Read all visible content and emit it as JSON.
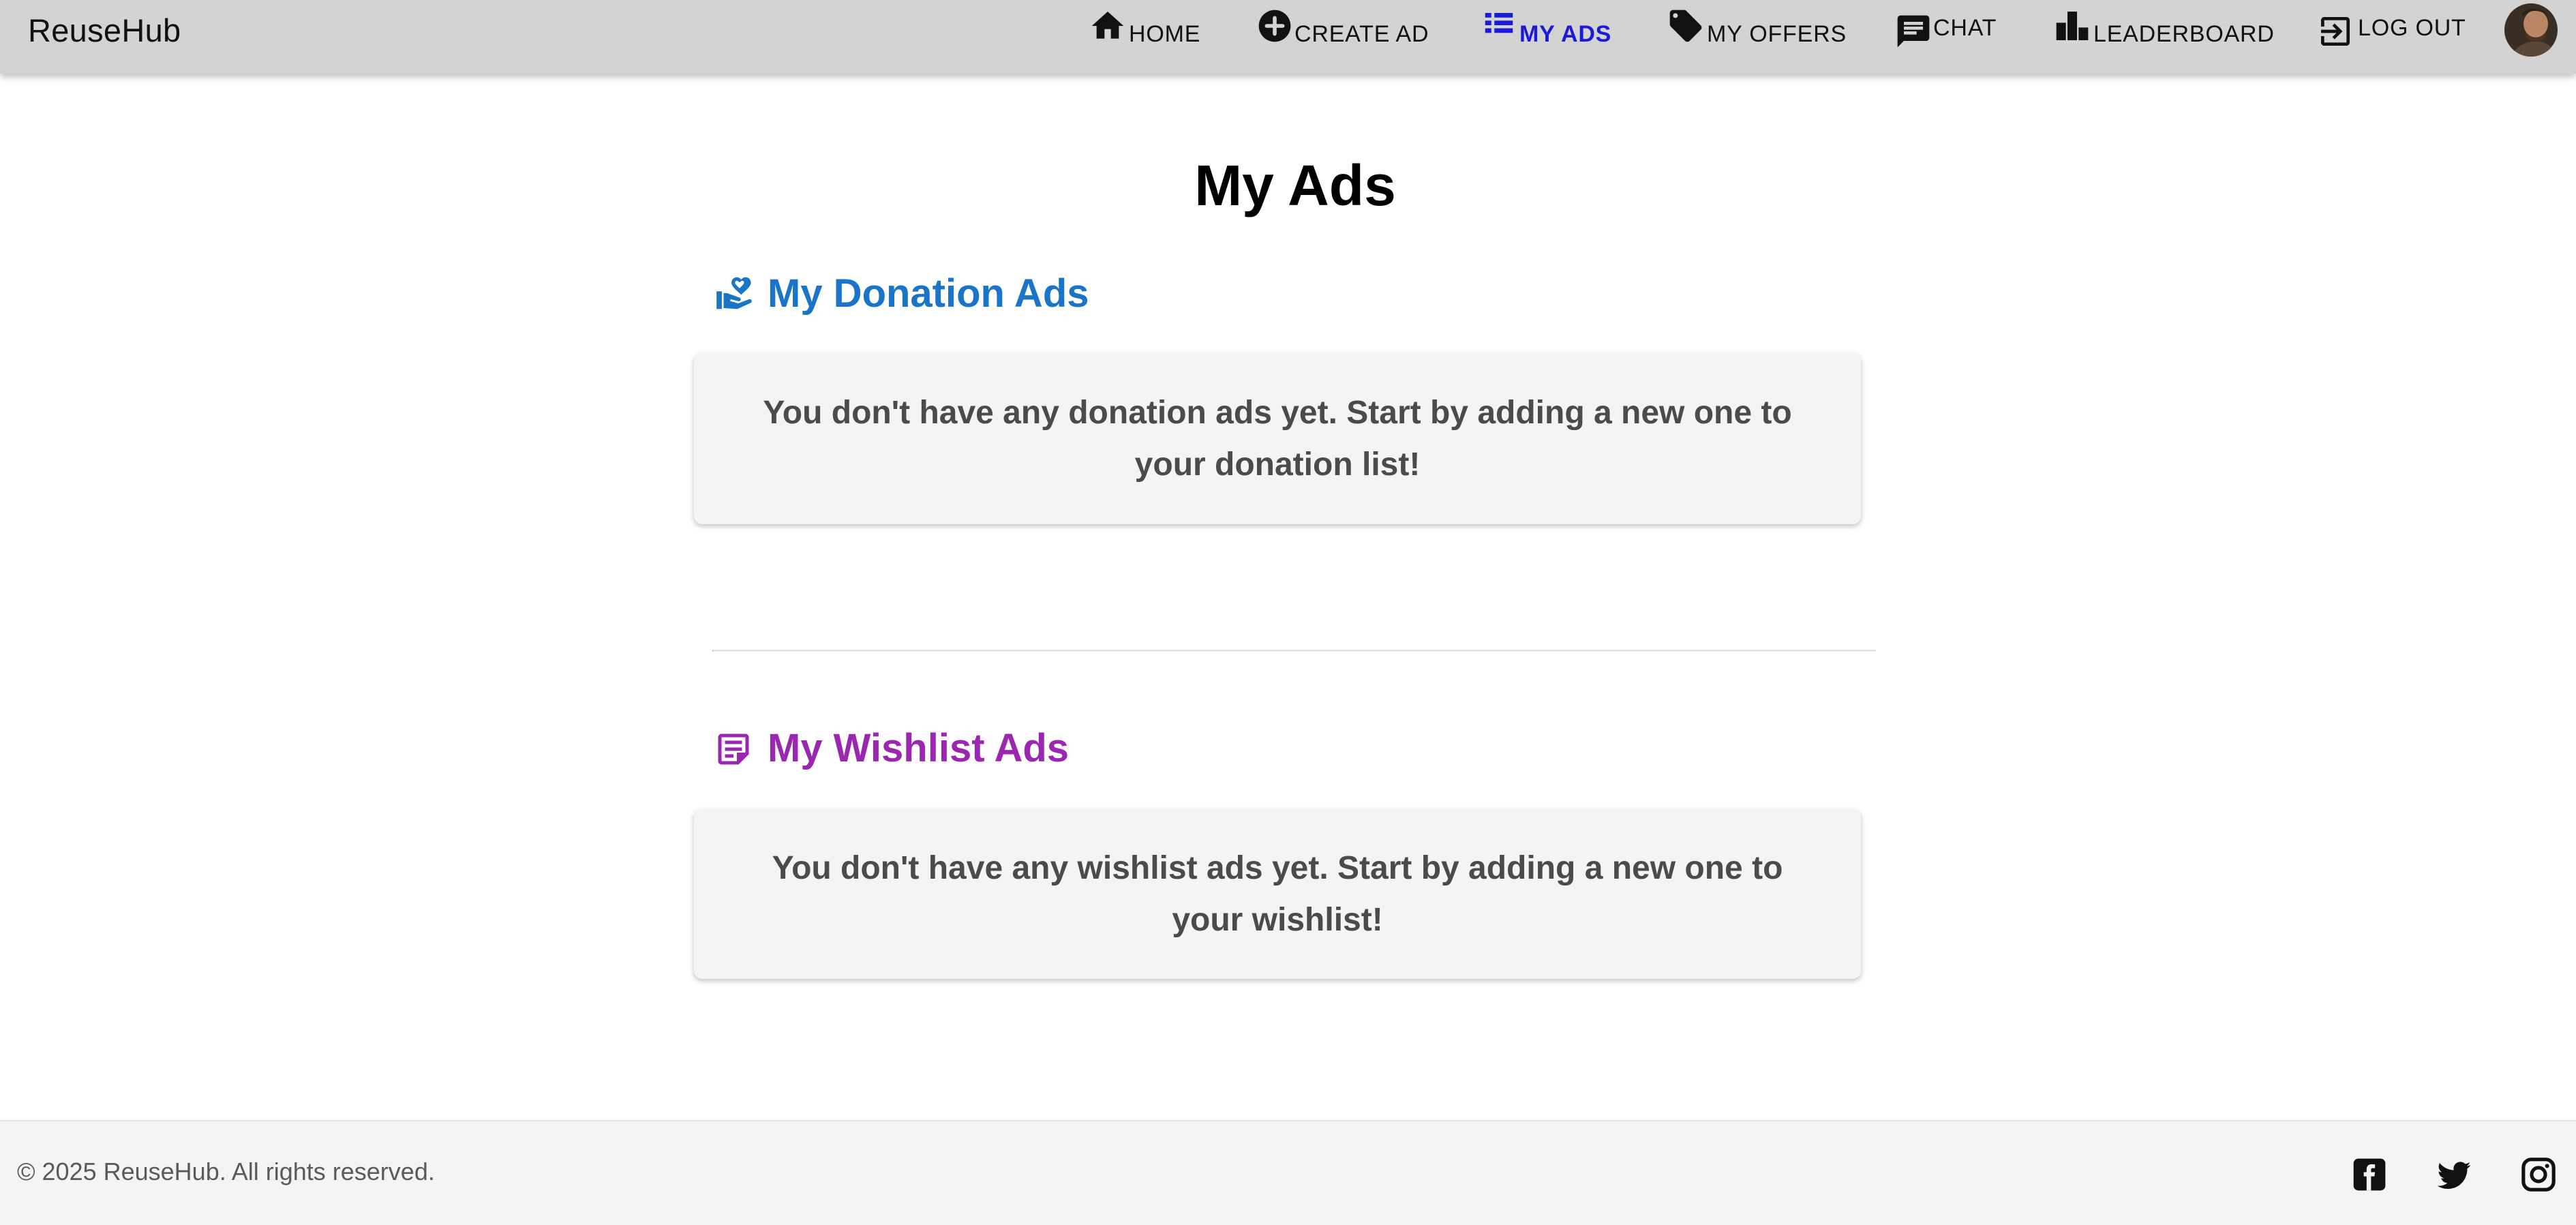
{
  "appbar": {
    "brand": "ReuseHub",
    "nav": {
      "home": {
        "label": "HOME",
        "icon": "home-icon"
      },
      "create_ad": {
        "label": "CREATE AD",
        "icon": "add-circle-icon"
      },
      "my_ads": {
        "label": "MY ADS",
        "icon": "list-icon",
        "active": true
      },
      "my_offers": {
        "label": "MY OFFERS",
        "icon": "tag-icon"
      },
      "chat": {
        "label": "CHAT",
        "icon": "chat-icon"
      },
      "leaderboard": {
        "label": "LEADERBOARD",
        "icon": "leaderboard-icon"
      },
      "logout": {
        "label": "LOG OUT",
        "icon": "logout-icon"
      }
    },
    "avatar": "user-avatar"
  },
  "main": {
    "title": "My Ads",
    "donation": {
      "heading": "My Donation Ads",
      "icon": "volunteer-hand-heart-icon",
      "empty_message": "You don't have any donation ads yet. Start by adding a new one to your donation list!"
    },
    "wishlist": {
      "heading": "My Wishlist Ads",
      "icon": "sticky-note-icon",
      "empty_message": "You don't have any wishlist ads yet. Start by adding a new one to your wishlist!"
    }
  },
  "footer": {
    "copyright": "© 2025 ReuseHub. All rights reserved.",
    "social": [
      "facebook-icon",
      "twitter-icon",
      "instagram-icon"
    ]
  },
  "colors": {
    "appbar_bg": "#d3d3d3",
    "active_nav": "#1a1adb",
    "donation_heading": "#1a75c9",
    "wishlist_heading": "#9b27b0",
    "card_bg": "#f3f4f6",
    "card_text": "#4b4b4b",
    "footer_bg": "#f4f4f4"
  }
}
